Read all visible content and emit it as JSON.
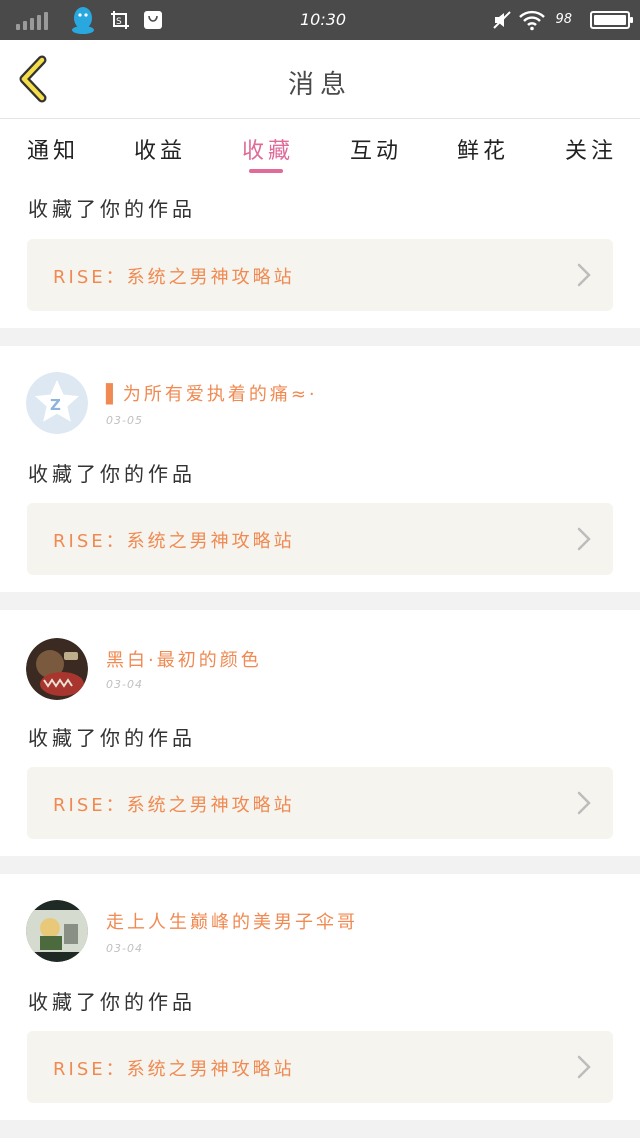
{
  "status_bar": {
    "time": "10:30",
    "battery": "98"
  },
  "header": {
    "title": "消息"
  },
  "tabs": [
    {
      "label": "通知"
    },
    {
      "label": "收益"
    },
    {
      "label": "收藏"
    },
    {
      "label": "互动"
    },
    {
      "label": "鲜花"
    },
    {
      "label": "关注"
    }
  ],
  "active_tab": "收藏",
  "items": [
    {
      "action": "收藏了你的作品",
      "work": "RISE：系统之男神攻略站"
    },
    {
      "user": "▌为所有爱执着的痛≈·",
      "date": "03-05",
      "action": "收藏了你的作品",
      "work": "RISE：系统之男神攻略站"
    },
    {
      "user": "黑白·最初的颜色",
      "date": "03-04",
      "action": "收藏了你的作品",
      "work": "RISE：系统之男神攻略站"
    },
    {
      "user": "走上人生巅峰的美男子伞哥",
      "date": "03-04",
      "action": "收藏了你的作品",
      "work": "RISE：系统之男神攻略站"
    }
  ],
  "colors": {
    "accent": "#e06b98",
    "username": "#f08a52",
    "status_bar": "#4a4a4a"
  }
}
